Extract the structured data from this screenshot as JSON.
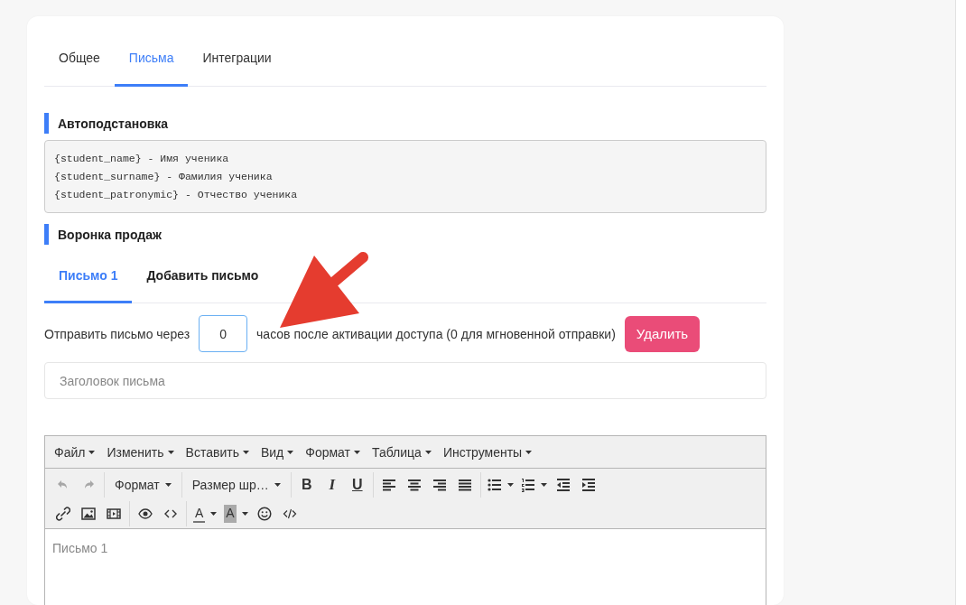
{
  "tabs": [
    {
      "label": "Общее",
      "selected": false
    },
    {
      "label": "Письма",
      "selected": true
    },
    {
      "label": "Интеграции",
      "selected": false
    }
  ],
  "autosubstitution": {
    "title": "Автоподстановка",
    "lines": [
      "{student_name} - Имя ученика",
      "{student_surname} - Фамилия ученика",
      "{student_patronymic} - Отчество ученика"
    ]
  },
  "funnel": {
    "title": "Воронка продаж"
  },
  "letter_tabs": [
    {
      "label": "Письмо 1",
      "selected": true
    },
    {
      "label": "Добавить письмо",
      "selected": false
    }
  ],
  "delay": {
    "label_before": "Отправить письмо через",
    "value": "0",
    "label_after": "часов после активации доступа (0 для мгновенной отправки)"
  },
  "delete_button": "Удалить",
  "subject_field": {
    "placeholder": "Заголовок письма"
  },
  "editor": {
    "menu": [
      "Файл",
      "Изменить",
      "Вставить",
      "Вид",
      "Формат",
      "Таблица",
      "Инструменты"
    ],
    "history": [
      {
        "disabled": true
      },
      {
        "disabled": true
      }
    ],
    "block_format": "Формат",
    "font_size": "Размер шр…",
    "text_styles": [
      "B",
      "I",
      "U"
    ],
    "text_color": "A",
    "highlight_color": "A",
    "content": "Письмо 1"
  }
}
